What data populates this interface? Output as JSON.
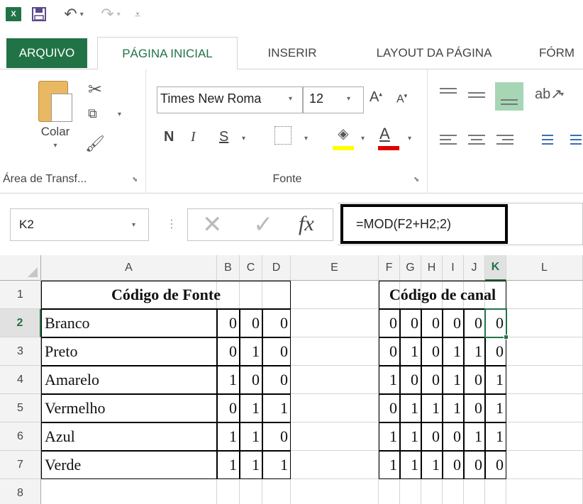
{
  "qat": {
    "logo_text": "X",
    "icons": [
      "excel-logo",
      "save-icon",
      "undo-icon",
      "redo-icon",
      "customize-qat-icon"
    ]
  },
  "tabs": [
    {
      "label": "ARQUIVO"
    },
    {
      "label": "PÁGINA INICIAL"
    },
    {
      "label": "INSERIR"
    },
    {
      "label": "LAYOUT DA PÁGINA"
    },
    {
      "label": "FÓRM"
    }
  ],
  "ribbon": {
    "clipboard": {
      "paste_label": "Colar",
      "group_label": "Área de Transf..."
    },
    "font": {
      "font_name": "Times New Roma",
      "font_size": "12",
      "bold": "N",
      "italic": "I",
      "underline": "S",
      "group_label": "Fonte",
      "fill_color": "#ffff00",
      "font_color": "#e00000"
    }
  },
  "formula_bar": {
    "name_box": "K2",
    "formula": "=MOD(F2+H2;2)"
  },
  "grid": {
    "columns": [
      "A",
      "B",
      "C",
      "D",
      "E",
      "F",
      "G",
      "H",
      "I",
      "J",
      "K",
      "L"
    ],
    "active_column": "K",
    "rows": [
      "1",
      "2",
      "3",
      "4",
      "5",
      "6",
      "7",
      "8"
    ],
    "active_row": "2",
    "source_header": "Código de Fonte",
    "channel_header": "Código de canal",
    "source_rows": [
      {
        "name": "Branco",
        "bits": [
          "0",
          "0",
          "0"
        ]
      },
      {
        "name": "Preto",
        "bits": [
          "0",
          "1",
          "0"
        ]
      },
      {
        "name": "Amarelo",
        "bits": [
          "1",
          "0",
          "0"
        ]
      },
      {
        "name": "Vermelho",
        "bits": [
          "0",
          "1",
          "1"
        ]
      },
      {
        "name": "Azul",
        "bits": [
          "1",
          "1",
          "0"
        ]
      },
      {
        "name": "Verde",
        "bits": [
          "1",
          "1",
          "1"
        ]
      }
    ],
    "channel_rows": [
      [
        "0",
        "0",
        "0",
        "0",
        "0",
        "0"
      ],
      [
        "0",
        "1",
        "0",
        "1",
        "1",
        "0"
      ],
      [
        "1",
        "0",
        "0",
        "1",
        "0",
        "1"
      ],
      [
        "0",
        "1",
        "1",
        "1",
        "0",
        "1"
      ],
      [
        "1",
        "1",
        "0",
        "0",
        "1",
        "1"
      ],
      [
        "1",
        "1",
        "1",
        "0",
        "0",
        "0"
      ]
    ]
  }
}
